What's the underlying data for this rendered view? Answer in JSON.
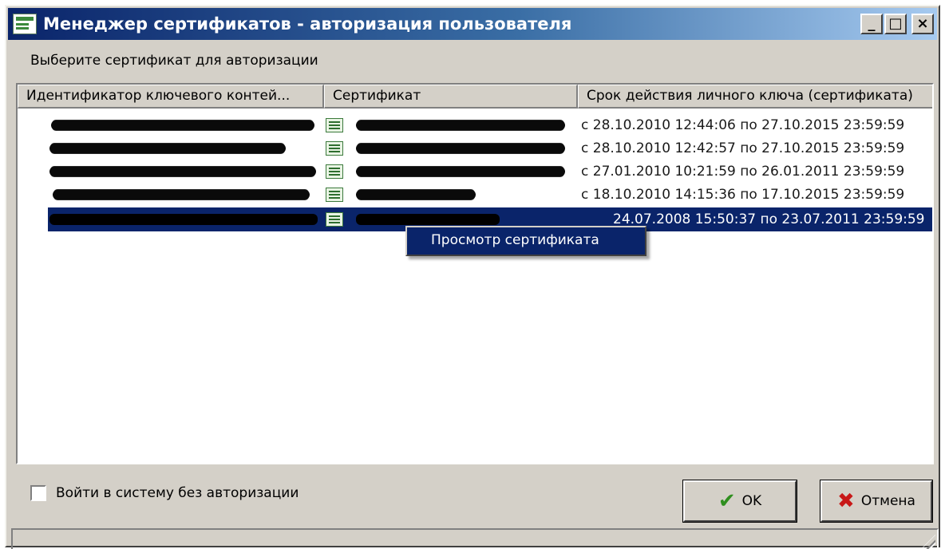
{
  "window": {
    "title": "Менеджер сертификатов - авторизация пользователя",
    "controls": {
      "minimize": "_",
      "maximize": "□",
      "close": "×"
    }
  },
  "prompt": "Выберите сертификат для авторизации",
  "list": {
    "columns": [
      "Идентификатор ключевого контей...",
      "Сертификат",
      "Срок действия личного ключа (сертификата)"
    ],
    "rows": [
      {
        "validity": "с 28.10.2010 12:44:06 по 27.10.2015 23:59:59",
        "selected": false
      },
      {
        "validity": "с 28.10.2010 12:42:57 по 27.10.2015 23:59:59",
        "selected": false
      },
      {
        "validity": "с 27.01.2010 10:21:59 по 26.01.2011 23:59:59",
        "selected": false
      },
      {
        "validity": "с 18.10.2010 14:15:36 по 17.10.2015 23:59:59",
        "selected": false
      },
      {
        "validity": "24.07.2008 15:50:37 по 23.07.2011 23:59:59",
        "selected": true
      }
    ]
  },
  "context_menu": {
    "item": "Просмотр сертификата"
  },
  "checkbox": {
    "label": "Войти в систему без авторизации",
    "checked": false
  },
  "buttons": {
    "ok": "OK",
    "cancel": "Отмена"
  },
  "icons": {
    "ok": "check-icon",
    "cancel": "cross-icon",
    "certificate": "certificate-icon"
  },
  "colors": {
    "selection": "#0a246a",
    "titlebar_start": "#0a246a",
    "ok_icon": "#2f8f1f",
    "cancel_icon": "#c81818"
  }
}
